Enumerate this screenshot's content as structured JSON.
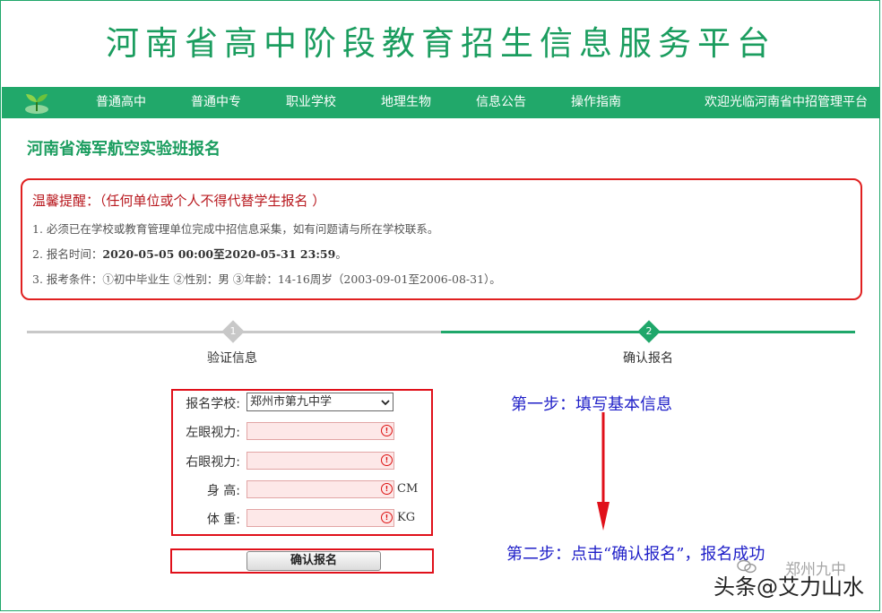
{
  "site": {
    "title": "河南省高中阶段教育招生信息服务平台"
  },
  "nav": {
    "items": [
      {
        "label": "普通高中"
      },
      {
        "label": "普通中专"
      },
      {
        "label": "职业学校"
      },
      {
        "label": "地理生物"
      },
      {
        "label": "信息公告"
      },
      {
        "label": "操作指南"
      }
    ],
    "welcome": "欢迎光临河南省中招管理平台"
  },
  "page": {
    "heading": "河南省海军航空实验班报名"
  },
  "notice": {
    "title": "温馨提醒：（任何单位或个人不得代替学生报名 ）",
    "line1": "1. 必须已在学校或教育管理单位完成中招信息采集，如有问题请与所在学校联系。",
    "line2_prefix": "2. 报名时间：",
    "line2_time": "2020-05-05 00:00至2020-05-31 23:59",
    "line2_suffix": "。",
    "line3": "3. 报考条件：①初中毕业生 ②性别：男 ③年龄：14-16周岁（2003-09-01至2006-08-31）。"
  },
  "steps": [
    {
      "number": "1",
      "label": "验证信息"
    },
    {
      "number": "2",
      "label": "确认报名"
    }
  ],
  "form": {
    "school_label": "报名学校:",
    "school_value": "郑州市第九中学",
    "left_eye_label": "左眼视力:",
    "right_eye_label": "右眼视力:",
    "height_label": "身 高:",
    "height_unit": "CM",
    "weight_label": "体 重:",
    "weight_unit": "KG",
    "submit_label": "确认报名"
  },
  "annotations": {
    "step1": "第一步：填写基本信息",
    "step2": "第二步：点击“确认报名”，报名成功"
  },
  "watermark": {
    "main": "头条@艾力山水",
    "secondary": "郑州九中"
  },
  "colors": {
    "brand_green": "#21a86a",
    "alert_red": "#e0101a",
    "annotation_blue": "#2020c8"
  }
}
